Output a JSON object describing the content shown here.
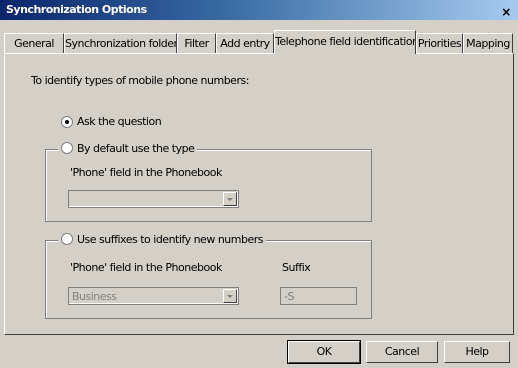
{
  "window": {
    "title": "Synchronization Options",
    "close_label": "×"
  },
  "tabs": [
    {
      "label": "General"
    },
    {
      "label": "Synchronization folder"
    },
    {
      "label": "Filter"
    },
    {
      "label": "Add entry"
    },
    {
      "label": "Telephone field identification",
      "active": true
    },
    {
      "label": "Priorities"
    },
    {
      "label": "Mapping"
    }
  ],
  "panel": {
    "intro": "To identify types of mobile phone numbers:",
    "options": {
      "ask": {
        "label": "Ask the question",
        "selected": true
      },
      "default_type": {
        "label": "By default use the type",
        "field_label": "'Phone' field in the Phonebook",
        "combo_value": ""
      },
      "suffixes": {
        "label": "Use suffixes to identify new numbers",
        "field_label": "'Phone' field in the Phonebook",
        "suffix_label": "Suffix",
        "combo_value": "Business",
        "suffix_value": "-S"
      }
    }
  },
  "buttons": {
    "ok": "OK",
    "cancel": "Cancel",
    "help": "Help"
  }
}
